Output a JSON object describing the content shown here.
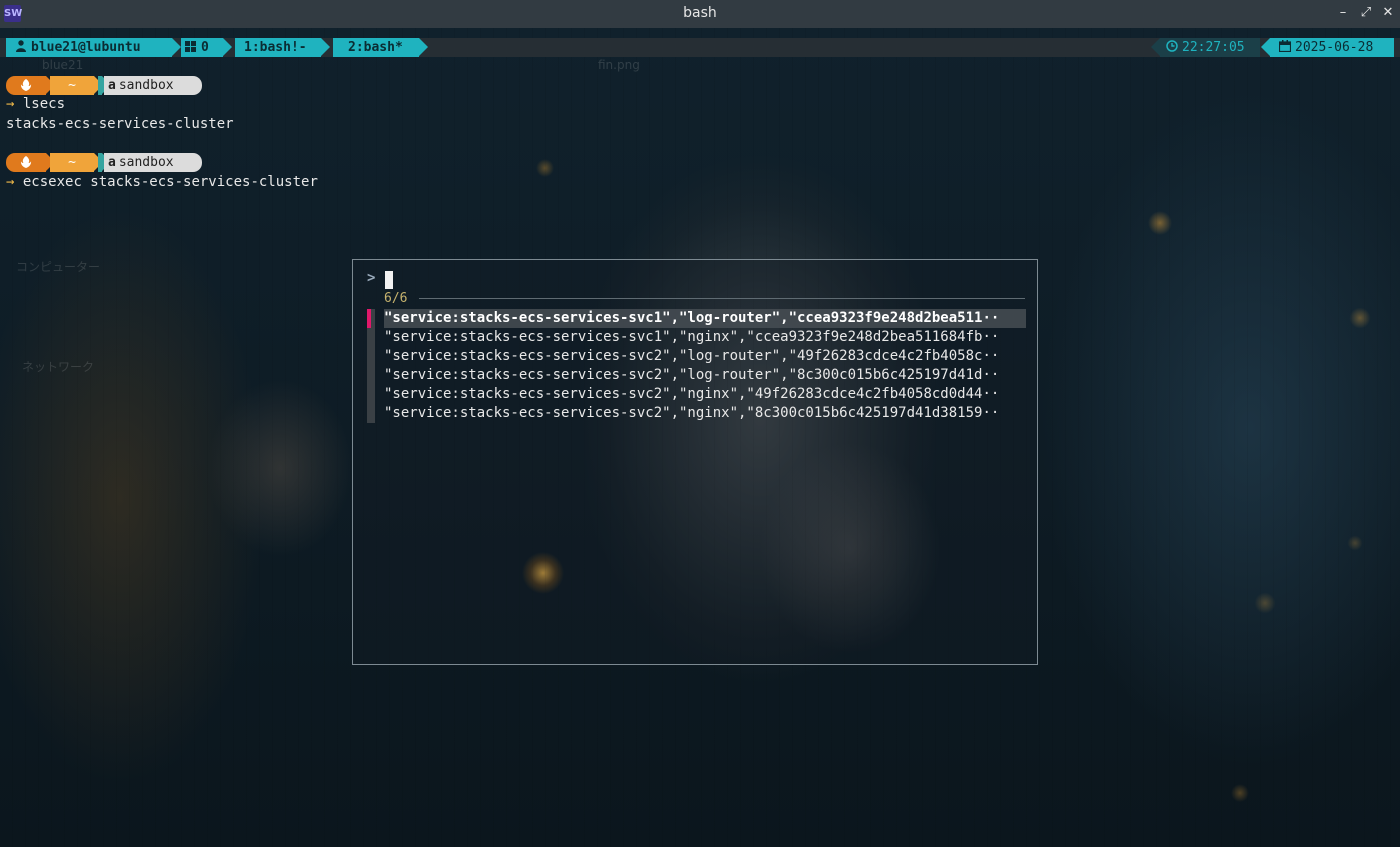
{
  "window": {
    "title": "bash",
    "app_icon": "SW",
    "controls": {
      "minimize": "–",
      "maximize": "⤢",
      "close": "✕"
    }
  },
  "statusbar": {
    "user": "blue21@lubuntu",
    "session": "0",
    "windows": [
      "1:bash!-",
      "2:bash*"
    ],
    "time": "22:27:05",
    "date": "2025-06-28"
  },
  "prompt": {
    "dir": "~",
    "context": "sandbox"
  },
  "terminal": {
    "commands": [
      {
        "input": "lsecs",
        "output": "stacks-ecs-services-cluster"
      },
      {
        "input": "ecsexec stacks-ecs-services-cluster",
        "output": ""
      }
    ]
  },
  "desktop_ghosts": [
    "blue21",
    "fin.png",
    "コンピューター",
    "ネットワーク"
  ],
  "fzf": {
    "pointer": ">",
    "count": "6/6",
    "items": [
      "\"service:stacks-ecs-services-svc1\",\"log-router\",\"ccea9323f9e248d2bea511··",
      "\"service:stacks-ecs-services-svc1\",\"nginx\",\"ccea9323f9e248d2bea511684fb··",
      "\"service:stacks-ecs-services-svc2\",\"log-router\",\"49f26283cdce4c2fb4058c··",
      "\"service:stacks-ecs-services-svc2\",\"log-router\",\"8c300c015b6c425197d41d··",
      "\"service:stacks-ecs-services-svc2\",\"nginx\",\"49f26283cdce4c2fb4058cd0d44··",
      "\"service:stacks-ecs-services-svc2\",\"nginx\",\"8c300c015b6c425197d41d38159··"
    ]
  },
  "colors": {
    "accent": "#1fb3bf",
    "selection_marker": "#e0186a",
    "prompt_orange": "#e07a1d",
    "prompt_amber": "#f0a43a"
  }
}
